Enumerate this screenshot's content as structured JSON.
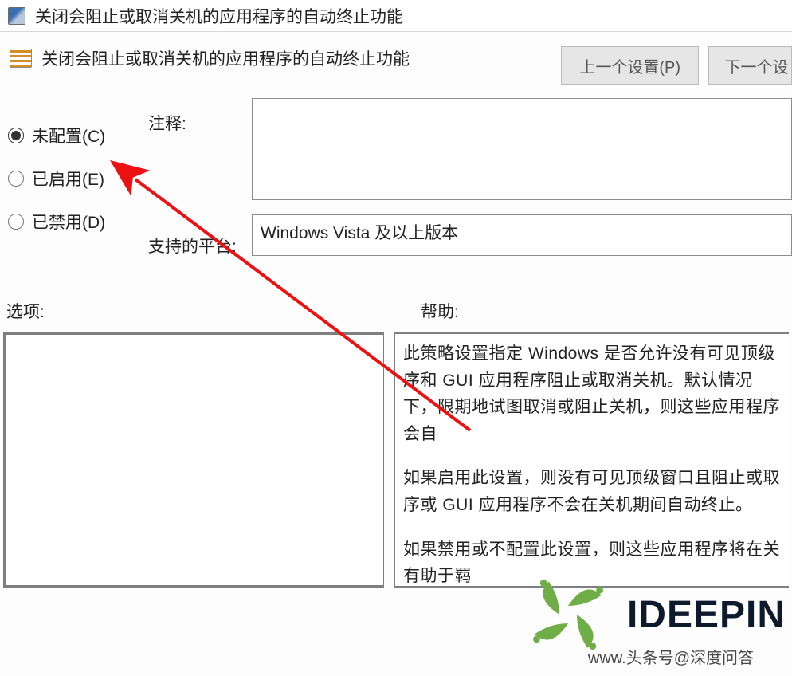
{
  "titlebar": {
    "title": "关闭会阻止或取消关机的应用程序的自动终止功能"
  },
  "header": {
    "title": "关闭会阻止或取消关机的应用程序的自动终止功能",
    "prev_button": "上一个设置(P)",
    "next_button": "下一个设"
  },
  "config": {
    "radios": [
      {
        "key": "not_configured",
        "label": "未配置(C)",
        "checked": true
      },
      {
        "key": "enabled",
        "label": "已启用(E)",
        "checked": false
      },
      {
        "key": "disabled",
        "label": "已禁用(D)",
        "checked": false
      }
    ],
    "comment_label": "注释:",
    "comment_value": "",
    "supported_label": "支持的平台:",
    "supported_value": "Windows Vista 及以上版本"
  },
  "lower": {
    "options_label": "选项:",
    "help_label": "帮助:",
    "help_paragraphs": [
      "此策略设置指定 Windows 是否允许没有可见顶级序和 GUI 应用程序阻止或取消关机。默认情况下，限期地试图取消或阻止关机，则这些应用程序会自",
      "如果启用此设置，则没有可见顶级窗口且阻止或取序或 GUI 应用程序不会在关机期间自动终止。",
      "如果禁用或不配置此设置，则这些应用程序将在关有助于羁"
    ]
  },
  "watermark": {
    "brand": "IDEEPIN",
    "attribution": "www.头条号@深度问答"
  }
}
